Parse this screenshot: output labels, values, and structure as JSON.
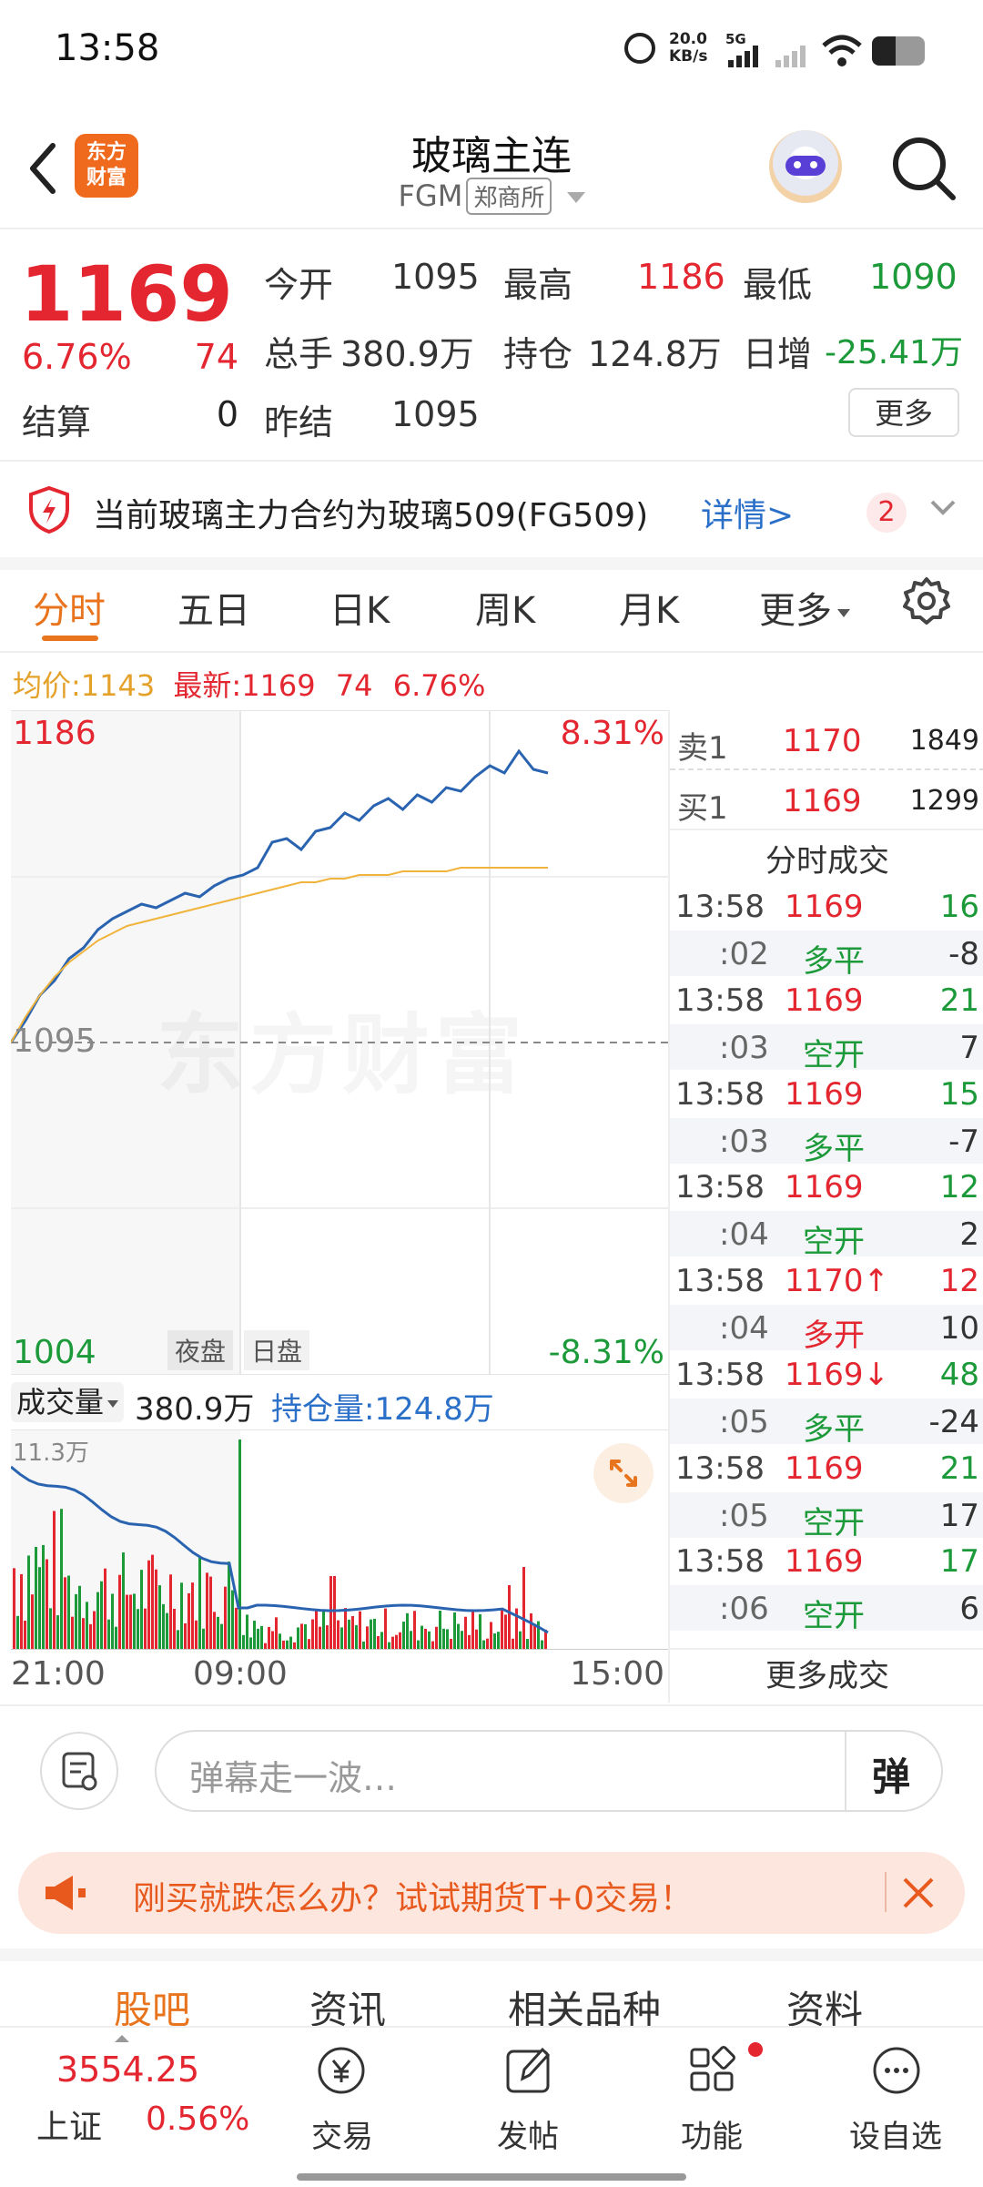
{
  "status_bar": {
    "time": "13:58",
    "net_speed": "20.0\nKB/s",
    "network": "5G"
  },
  "header": {
    "title": "玻璃主连",
    "code": "FGM",
    "exchange": "郑商所",
    "logo_line1": "东方",
    "logo_line2": "财富"
  },
  "quote": {
    "price": "1169",
    "change_pct": "6.76%",
    "change": "74",
    "settle_label": "结算",
    "settle_value": "0",
    "open_label": "今开",
    "open_value": "1095",
    "high_label": "最高",
    "high_value": "1186",
    "low_label": "最低",
    "low_value": "1090",
    "volume_label": "总手",
    "volume_value": "380.9万",
    "oi_label": "持仓",
    "oi_value": "124.8万",
    "daily_inc_label": "日增",
    "daily_inc_value": "-25.41万",
    "prev_settle_label": "昨结",
    "prev_settle_value": "1095",
    "more_label": "更多"
  },
  "notice": {
    "text": "当前玻璃主力合约为玻璃509(FG509)",
    "link": "详情>",
    "count": "2"
  },
  "tabs": [
    "分时",
    "五日",
    "日K",
    "周K",
    "月K",
    "更多"
  ],
  "chart_info": {
    "avg_label": "均价:",
    "avg_value": "1143",
    "latest_label": "最新:",
    "latest_value": "1169",
    "latest_change": "74",
    "latest_pct": "6.76%"
  },
  "chart_data": {
    "type": "line",
    "y_top": "1186",
    "y_mid": "1095",
    "y_bottom": "1004",
    "pct_top": "8.31%",
    "pct_bottom": "-8.31%",
    "x_labels": [
      "21:00",
      "09:00",
      "15:00"
    ],
    "session_labels": [
      "夜盘",
      "日盘"
    ],
    "ylim": [
      1004,
      1186
    ],
    "series": [
      {
        "name": "最新",
        "color": "#2a64b0",
        "values": [
          1095,
          1101,
          1108,
          1112,
          1118,
          1121,
          1126,
          1129,
          1131,
          1133,
          1132,
          1134,
          1136,
          1135,
          1138,
          1140,
          1141,
          1143,
          1150,
          1151,
          1148,
          1153,
          1154,
          1158,
          1156,
          1160,
          1162,
          1159,
          1163,
          1161,
          1165,
          1164,
          1168,
          1171,
          1169,
          1175,
          1170,
          1169
        ]
      },
      {
        "name": "均价",
        "color": "#f0b43c",
        "values": [
          1095,
          1102,
          1108,
          1113,
          1117,
          1120,
          1123,
          1125,
          1127,
          1128,
          1129,
          1130,
          1131,
          1132,
          1133,
          1134,
          1135,
          1136,
          1137,
          1138,
          1139,
          1139,
          1140,
          1140,
          1141,
          1141,
          1141,
          1142,
          1142,
          1142,
          1142,
          1143,
          1143,
          1143,
          1143,
          1143,
          1143,
          1143
        ]
      }
    ]
  },
  "volume_bar": {
    "label": "成交量",
    "value": "380.9万",
    "oi_label": "持仓量:124.8万",
    "max_label": "11.3万"
  },
  "order_book": [
    {
      "side": "卖1",
      "price": "1170",
      "vol": "1849"
    },
    {
      "side": "买1",
      "price": "1169",
      "vol": "1299"
    }
  ],
  "trades_title": "分时成交",
  "trades": [
    {
      "time": "13:58",
      "price": "1169",
      "arrow": "",
      "vol": "16",
      "sub_time": ":02",
      "type": "多平",
      "type_vol": "-8",
      "type_color": "green",
      "vol_color": "green"
    },
    {
      "time": "13:58",
      "price": "1169",
      "arrow": "",
      "vol": "21",
      "sub_time": ":03",
      "type": "空开",
      "type_vol": "7",
      "type_color": "green",
      "vol_color": "green"
    },
    {
      "time": "13:58",
      "price": "1169",
      "arrow": "",
      "vol": "15",
      "sub_time": ":03",
      "type": "多平",
      "type_vol": "-7",
      "type_color": "green",
      "vol_color": "green"
    },
    {
      "time": "13:58",
      "price": "1169",
      "arrow": "",
      "vol": "12",
      "sub_time": ":04",
      "type": "空开",
      "type_vol": "2",
      "type_color": "green",
      "vol_color": "green"
    },
    {
      "time": "13:58",
      "price": "1170",
      "arrow": "↑",
      "vol": "12",
      "sub_time": ":04",
      "type": "多开",
      "type_vol": "10",
      "type_color": "red",
      "vol_color": "red"
    },
    {
      "time": "13:58",
      "price": "1169",
      "arrow": "↓",
      "vol": "48",
      "sub_time": ":05",
      "type": "多平",
      "type_vol": "-24",
      "type_color": "green",
      "vol_color": "green"
    },
    {
      "time": "13:58",
      "price": "1169",
      "arrow": "",
      "vol": "21",
      "sub_time": ":05",
      "type": "空开",
      "type_vol": "17",
      "type_color": "green",
      "vol_color": "green"
    },
    {
      "time": "13:58",
      "price": "1169",
      "arrow": "",
      "vol": "17",
      "sub_time": ":06",
      "type": "空开",
      "type_vol": "6",
      "type_color": "green",
      "vol_color": "green"
    }
  ],
  "more_trades": "更多成交",
  "comment": {
    "placeholder": "弹幕走一波…",
    "danmu_btn": "弹"
  },
  "promo": {
    "text": "刚买就跌怎么办？试试期货T+0交易！"
  },
  "bottom_tabs": [
    "股吧",
    "资讯",
    "相关品种",
    "资料"
  ],
  "index": {
    "value": "3554.25",
    "name": "上证",
    "pct": "0.56%"
  },
  "nav": [
    "交易",
    "发帖",
    "功能",
    "设自选"
  ],
  "colors": {
    "up": "#e3262f",
    "down": "#1c9a3a",
    "accent": "#e8741e",
    "price_line": "#2a64b0",
    "avg_line": "#f0b43c"
  }
}
